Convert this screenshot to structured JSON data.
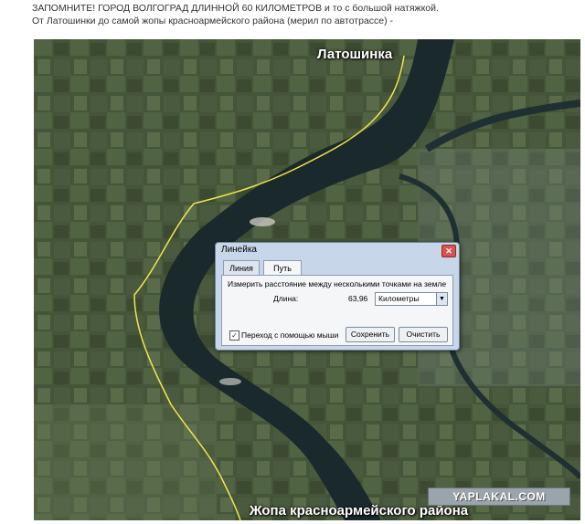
{
  "caption": {
    "line1": "ЗАПОМНИТЕ! ГОРОД ВОЛГОГРАД ДЛИННОЙ 60 КИЛОМЕТРОВ и то с большой натяжкой.",
    "line2": "От Латошинки до самой жопы красноармейского района (мерил по автотрассе) -"
  },
  "map": {
    "label_top": "Латошинка",
    "label_bottom": "Жопа красноармейского района",
    "watermark": "YAPLAKAL.COM",
    "route_color": "#f2e64a",
    "river_color": "#1a2a2c"
  },
  "dialog": {
    "title": "Линейка",
    "close_icon": "close-icon",
    "tabs": [
      {
        "label": "Линия"
      },
      {
        "label": "Путь"
      }
    ],
    "hint": "Измерить расстояние между несколькими точками на земле",
    "length_label": "Длина:",
    "length_value": "63,96",
    "unit": "Километры",
    "mouse_nav_label": "Переход с помощью мыши",
    "save_label": "Сохренить",
    "clear_label": "Очистить"
  }
}
